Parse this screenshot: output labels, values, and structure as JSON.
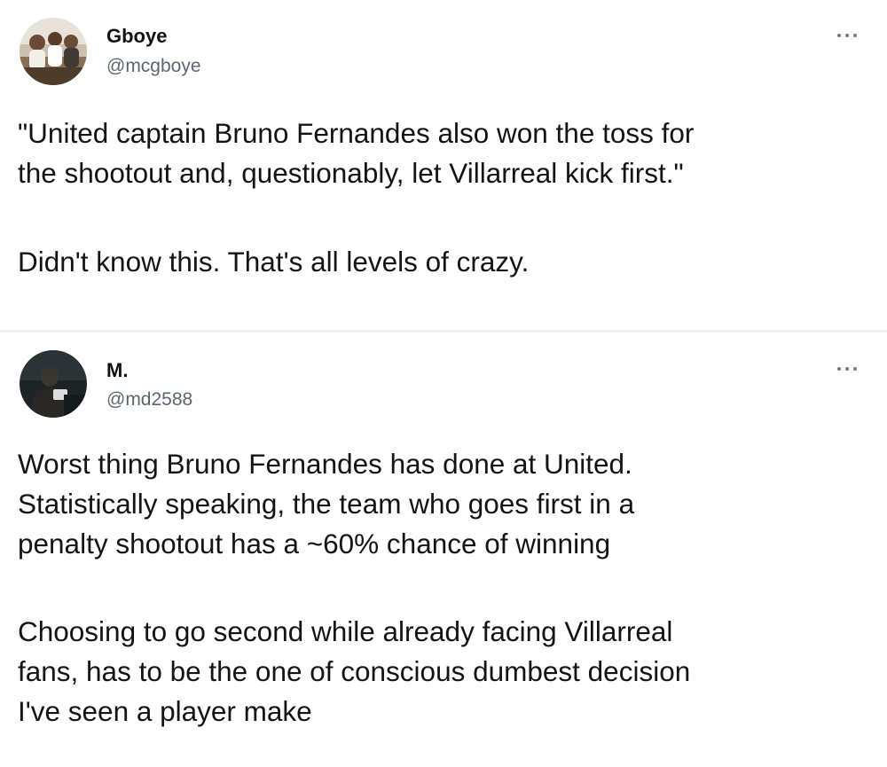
{
  "tweets": [
    {
      "author": {
        "name": "Gboye",
        "handle": "@mcgboye"
      },
      "more_icon": "more-horizontal-icon",
      "paragraphs": [
        {
          "lines": [
            "\"United captain Bruno Fernandes also won the toss for",
            "the shootout and, questionably, let Villarreal kick first.\""
          ]
        },
        {
          "lines": [
            "Didn't know this. That's all levels of crazy."
          ]
        }
      ]
    },
    {
      "author": {
        "name": "M.",
        "handle": "@md2588"
      },
      "more_icon": "more-horizontal-icon",
      "paragraphs": [
        {
          "lines": [
            "Worst thing Bruno Fernandes has done at United.",
            "Statistically speaking, the team who goes first in a",
            "penalty shootout has a ~60% chance of winning"
          ]
        },
        {
          "lines": [
            "Choosing to go second while already facing Villarreal",
            "fans, has to be the one of conscious dumbest decision",
            "I've seen a player make"
          ]
        }
      ]
    }
  ],
  "colors": {
    "text": "#141414",
    "handle": "#5b6670",
    "separator": "#eef1f3",
    "icon": "#6e7a85"
  }
}
